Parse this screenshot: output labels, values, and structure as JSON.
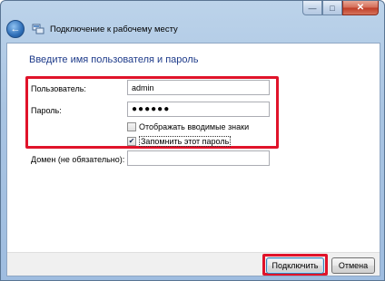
{
  "window": {
    "title": "Подключение к рабочему месту",
    "caption_minimize": "—",
    "caption_maximize": "□",
    "caption_close": "✕"
  },
  "form": {
    "heading": "Введите имя пользователя и пароль",
    "username_label": "Пользователь:",
    "username_value": "admin",
    "password_label": "Пароль:",
    "password_value": "●●●●●●",
    "show_chars_label": "Отображать вводимые знаки",
    "show_chars_checked": false,
    "remember_label": "Запомнить этот пароль",
    "remember_checked": true,
    "domain_label": "Домен (не обязательно):",
    "domain_value": ""
  },
  "buttons": {
    "connect_label": "Подключить",
    "cancel_label": "Отмена"
  },
  "colors": {
    "highlight": "#e0132a",
    "heading": "#1e3b8a"
  }
}
